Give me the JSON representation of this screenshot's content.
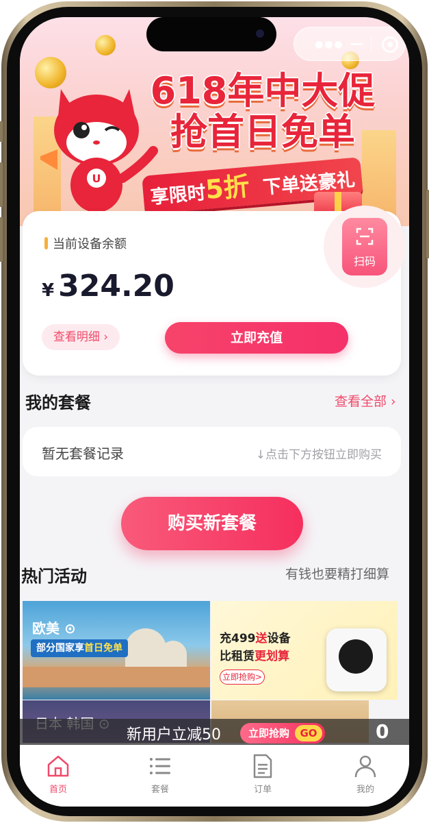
{
  "banner": {
    "headline_line1": "618年中大促",
    "headline_line2": "抢首日免单",
    "ribbon_prefix": "享限时",
    "ribbon_discount": "5折",
    "ribbon_suffix": "下单送豪礼",
    "mascot_badge": "U"
  },
  "balance_card": {
    "label": "当前设备余额",
    "currency": "¥",
    "amount": "324.20",
    "scan_label": "扫码",
    "detail_label": "查看明细 ›",
    "recharge_label": "立即充值"
  },
  "my_package": {
    "title": "我的套餐",
    "view_all": "查看全部 ›",
    "empty_text": "暂无套餐记录",
    "hint": "↓点击下方按钮立即购买",
    "buy_label": "购买新套餐"
  },
  "hot_activities": {
    "title": "热门活动",
    "subtitle": "有钱也要精打细算",
    "promo1": {
      "title": "欧美 ⊙",
      "tag_prefix": "部分国家享",
      "tag_highlight": "首日免单"
    },
    "promo2": {
      "line1_a": "充499",
      "line1_b": "送",
      "line1_c": "设备",
      "line2_a": "比租赁",
      "line2_b": "更划算",
      "button": "立即抢购>"
    },
    "promo3": {
      "title": "日本 韩国 ⊙"
    }
  },
  "floating_offer": {
    "text": "新用户立减50",
    "button": "立即抢购",
    "go": "GO",
    "side": "0"
  },
  "tabbar": {
    "items": [
      {
        "label": "首页",
        "icon": "home-icon",
        "active": true
      },
      {
        "label": "套餐",
        "icon": "list-icon",
        "active": false
      },
      {
        "label": "订单",
        "icon": "document-icon",
        "active": false
      },
      {
        "label": "我的",
        "icon": "user-icon",
        "active": false
      }
    ]
  },
  "colors": {
    "accent": "#f5306a",
    "link": "#f04a6a",
    "background": "#f4f4f7"
  }
}
